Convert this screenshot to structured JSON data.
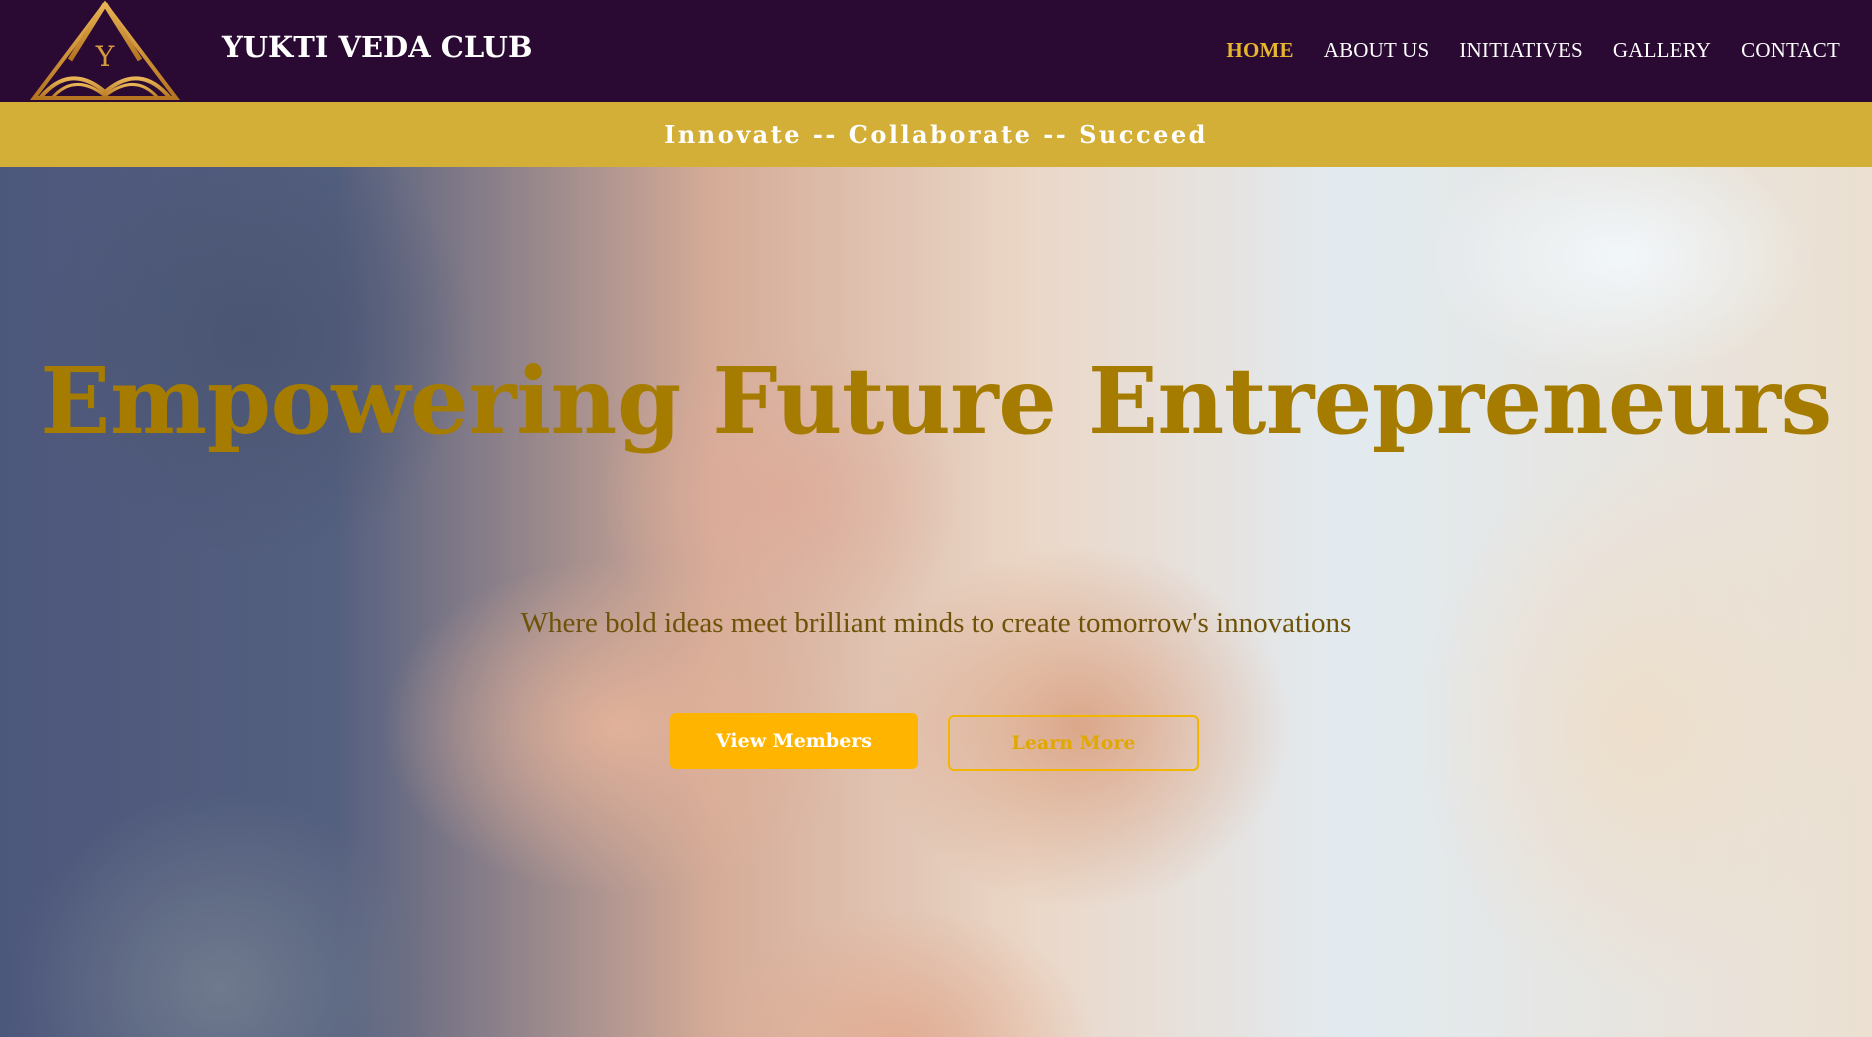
{
  "header": {
    "logo_letter": "Y",
    "brand": "YUKTI VEDA CLUB",
    "nav": [
      {
        "label": "HOME",
        "active": true
      },
      {
        "label": "ABOUT US",
        "active": false
      },
      {
        "label": "INITIATIVES",
        "active": false
      },
      {
        "label": "GALLERY",
        "active": false
      },
      {
        "label": "CONTACT",
        "active": false
      }
    ]
  },
  "tagline": "Innovate -- Collaborate -- Succeed",
  "hero": {
    "title": "Empowering Future Entrepreneurs",
    "subtitle": "Where bold ideas meet brilliant minds to create tomorrow's innovations",
    "primary_button": "View Members",
    "secondary_button": "Learn More"
  },
  "colors": {
    "header_bg": "#2a0a33",
    "gold": "#d4af37",
    "accent": "#ffb400",
    "title": "#a67c00"
  }
}
